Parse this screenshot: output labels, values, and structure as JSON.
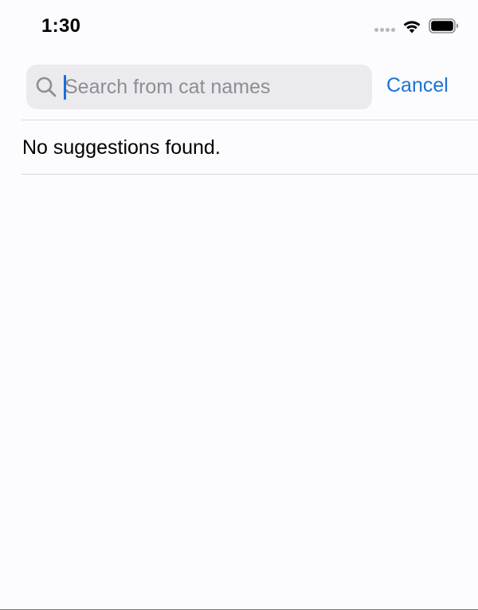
{
  "status_bar": {
    "time": "1:30",
    "icons": [
      "signal-dots-icon",
      "wifi-icon",
      "battery-icon"
    ]
  },
  "search": {
    "placeholder": "Search from cat names",
    "value": "",
    "cancel_label": "Cancel"
  },
  "results": {
    "empty_message": "No suggestions found."
  },
  "colors": {
    "accent": "#1a72d8",
    "background": "#fcfbfe",
    "field_background": "#ebeaef",
    "placeholder": "#8d8d92",
    "divider": "#d8d8dc"
  }
}
